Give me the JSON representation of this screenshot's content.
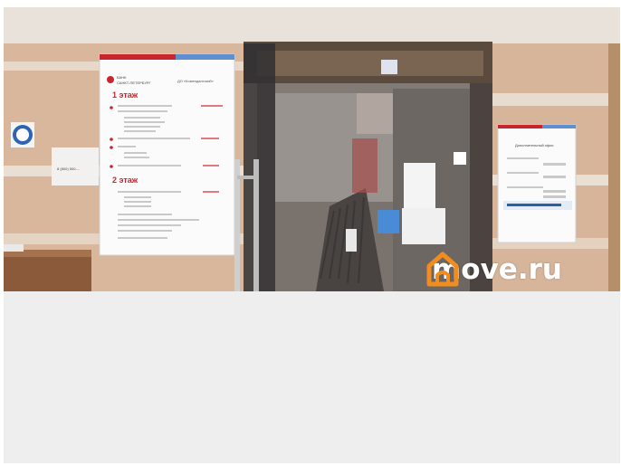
{
  "left_sign": {
    "bank_name_line1": "БАНК",
    "bank_name_line2": "САНКТ-ПЕТЕРБУРГ",
    "office_name": "ДО «Комендантский»",
    "floor1_heading": "1 этаж",
    "floor2_heading": "2 этаж"
  },
  "right_sign": {
    "title": "Дополнительный офис"
  },
  "small_sign": {
    "phone": "8 (800) 500-..."
  },
  "watermark": {
    "text": "move.ru",
    "icon": "house-icon",
    "accent_color": "#f28c1e"
  }
}
